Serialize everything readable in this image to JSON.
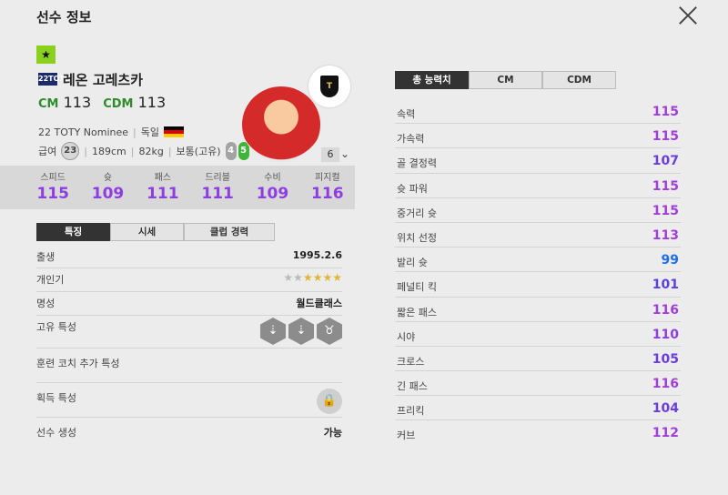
{
  "header": {
    "title": "선수 정보"
  },
  "player": {
    "season_badge": "22TOTY",
    "name": "레온 고레츠카",
    "positions": [
      {
        "pos": "CM",
        "ovr": "113"
      },
      {
        "pos": "CDM",
        "ovr": "113"
      }
    ],
    "season_name": "22 TOTY Nominee",
    "sep": "|",
    "nationality": "독일",
    "salary_label": "급여",
    "salary": "23",
    "height": "189cm",
    "weight": "82kg",
    "body": "보통(고유)",
    "weak_foot": "4",
    "strong_foot": "5",
    "level": "6"
  },
  "stats": [
    {
      "label": "스피드",
      "value": "115"
    },
    {
      "label": "슛",
      "value": "109"
    },
    {
      "label": "패스",
      "value": "111"
    },
    {
      "label": "드리블",
      "value": "111"
    },
    {
      "label": "수비",
      "value": "109"
    },
    {
      "label": "피지컬",
      "value": "116"
    }
  ],
  "left_tabs": [
    "특징",
    "시세",
    "클럽 경력"
  ],
  "info": {
    "birth_label": "출생",
    "birth": "1995.2.6",
    "skill_label": "개인기",
    "skill_stars": 4,
    "fame_label": "명성",
    "fame": "월드클래스",
    "traits_label": "고유 특성",
    "coach_label": "훈련 코치 추가 특성",
    "acquired_label": "획득 특성",
    "create_label": "선수 생성",
    "create": "가능"
  },
  "right_tabs": [
    "총 능력치",
    "CM",
    "CDM"
  ],
  "colors": {
    "purple": "#8e3ee0",
    "blue_violet": "#5a4fe0",
    "blue": "#1e6fe8"
  },
  "abilities": [
    {
      "label": "속력",
      "value": "115",
      "color": "#a23ed8"
    },
    {
      "label": "가속력",
      "value": "115",
      "color": "#a23ed8"
    },
    {
      "label": "골 결정력",
      "value": "107",
      "color": "#6a3de0"
    },
    {
      "label": "슛 파워",
      "value": "115",
      "color": "#a23ed8"
    },
    {
      "label": "중거리 슛",
      "value": "115",
      "color": "#a23ed8"
    },
    {
      "label": "위치 선정",
      "value": "113",
      "color": "#a23ed8"
    },
    {
      "label": "발리 슛",
      "value": "99",
      "color": "#1e6fe8"
    },
    {
      "label": "페널티 킥",
      "value": "101",
      "color": "#5a3fe0"
    },
    {
      "label": "짧은 패스",
      "value": "116",
      "color": "#a23ed8"
    },
    {
      "label": "시야",
      "value": "110",
      "color": "#8e3ee0"
    },
    {
      "label": "크로스",
      "value": "105",
      "color": "#6a3de0"
    },
    {
      "label": "긴 패스",
      "value": "116",
      "color": "#a23ed8"
    },
    {
      "label": "프리킥",
      "value": "104",
      "color": "#6a3de0"
    },
    {
      "label": "커브",
      "value": "112",
      "color": "#a23ed8"
    }
  ]
}
